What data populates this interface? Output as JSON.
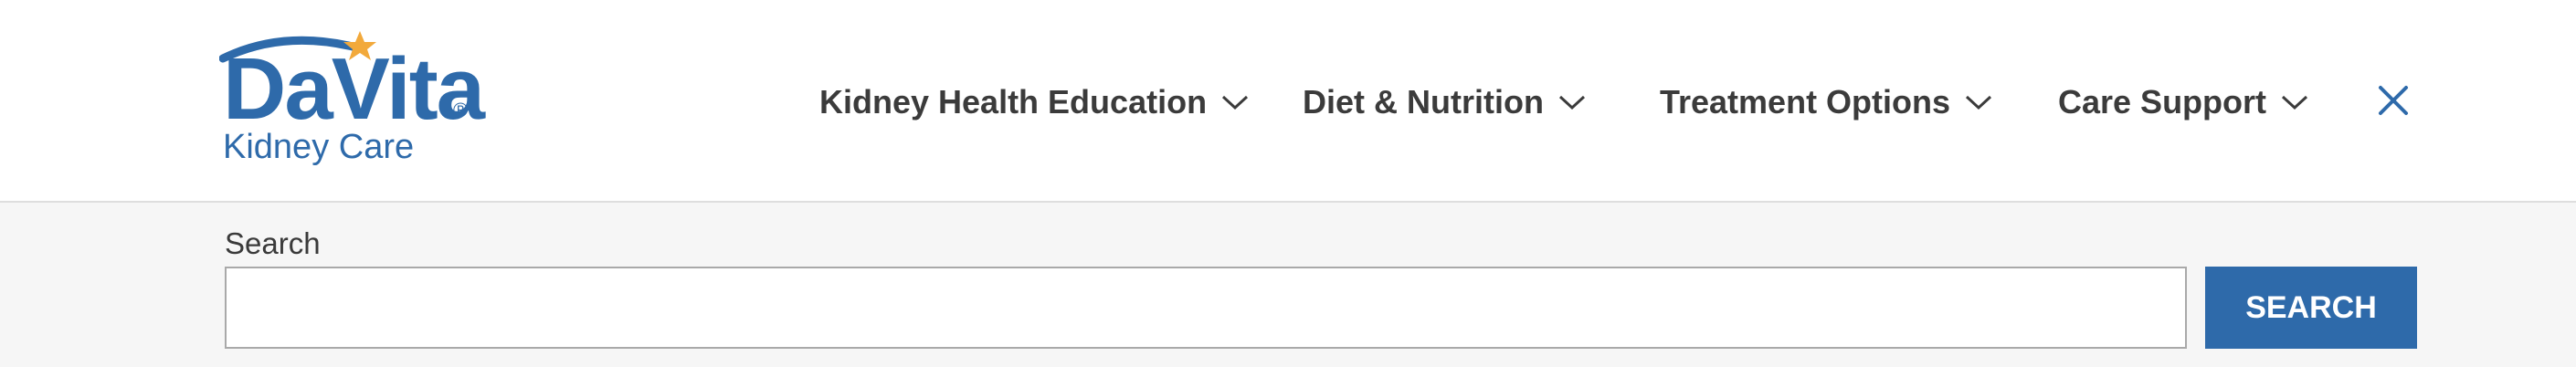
{
  "brand": {
    "name": "DaVita",
    "subtitle": "Kidney Care",
    "registered_mark": "®",
    "colors": {
      "primary": "#2e6aaa",
      "star": "#f2a93b"
    }
  },
  "nav": {
    "items": [
      {
        "label": "Kidney Health Education",
        "icon": "chevron-down-icon"
      },
      {
        "label": "Diet & Nutrition",
        "icon": "chevron-down-icon"
      },
      {
        "label": "Treatment Options",
        "icon": "chevron-down-icon"
      },
      {
        "label": "Care Support",
        "icon": "chevron-down-icon"
      }
    ],
    "close_icon": "close-icon"
  },
  "search": {
    "label": "Search",
    "value": "",
    "placeholder": "",
    "button_label": "SEARCH"
  }
}
